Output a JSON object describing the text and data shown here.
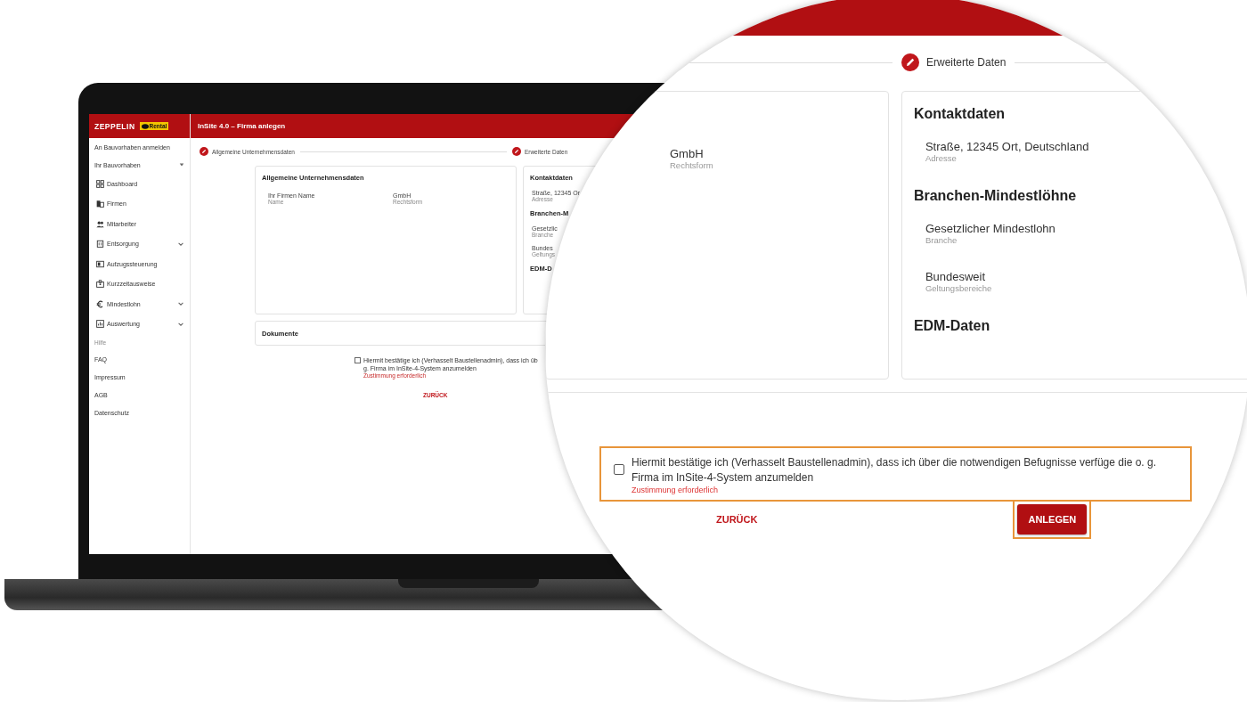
{
  "app": {
    "brand": {
      "name": "ZEPPELIN",
      "badge": "Rental"
    },
    "header_title": "InSite 4.0 – Firma anlegen",
    "sidebar": [
      {
        "kind": "link",
        "label": "An Bauvorhaben anmelden"
      },
      {
        "kind": "group",
        "label": "Ihr Bauvorhaben"
      },
      {
        "kind": "nav",
        "label": "Dashboard",
        "expandable": false
      },
      {
        "kind": "nav",
        "label": "Firmen",
        "expandable": false
      },
      {
        "kind": "nav",
        "label": "Mitarbeiter",
        "expandable": false
      },
      {
        "kind": "nav",
        "label": "Entsorgung",
        "expandable": true
      },
      {
        "kind": "nav",
        "label": "Aufzugssteuerung",
        "expandable": false
      },
      {
        "kind": "nav",
        "label": "Kurzzeitausweise",
        "expandable": false
      },
      {
        "kind": "nav",
        "label": "Mindestlohn",
        "expandable": true
      },
      {
        "kind": "nav",
        "label": "Auswertung",
        "expandable": true
      },
      {
        "kind": "section",
        "label": "Hilfe"
      },
      {
        "kind": "link",
        "label": "FAQ"
      },
      {
        "kind": "link",
        "label": "Impressum"
      },
      {
        "kind": "link",
        "label": "AGB"
      },
      {
        "kind": "link",
        "label": "Datenschutz"
      }
    ],
    "steps": [
      {
        "label": "Allgemeine Unternehmensdaten"
      },
      {
        "label": "Erweiterte Daten"
      }
    ],
    "general_card": {
      "title": "Allgemeine Unternehmensdaten",
      "fields": [
        {
          "value": "Ihr Firmen Name",
          "label": "Name"
        },
        {
          "value": "GmbH",
          "label": "Rechtsform"
        }
      ]
    },
    "extended_card": {
      "sections": [
        {
          "title": "Kontaktdaten",
          "fields": [
            {
              "value": "Straße, 12345 Or",
              "label": "Adresse"
            }
          ]
        },
        {
          "title": "Branchen-M",
          "fields": [
            {
              "value": "Gesetzlic",
              "label": "Branche"
            },
            {
              "value": "Bundes",
              "label": "Geltungs"
            }
          ]
        },
        {
          "title": "EDM-D"
        }
      ]
    },
    "documents_title": "Dokumente",
    "consent": {
      "checked": false,
      "lines": [
        "Hiermit bestätige ich (Verhasselt Baustellenadmin), dass ich üb",
        "g. Firma im InSite-4-System anzumelden"
      ],
      "error": "Zustimmung erforderlich"
    },
    "back_button": "ZURÜCK"
  },
  "magnifier": {
    "step_label": "Erweiterte Daten",
    "left_fields": [
      {
        "value": "GmbH",
        "label": "Rechtsform"
      }
    ],
    "sections": [
      {
        "title": "Kontaktdaten",
        "fields": [
          {
            "value": "Straße, 12345 Ort, Deutschland",
            "label": "Adresse"
          }
        ]
      },
      {
        "title": "Branchen-Mindestlöhne",
        "fields": [
          {
            "value": "Gesetzlicher Mindestlohn",
            "label": "Branche"
          },
          {
            "value": "Bundesweit",
            "label": "Geltungsbereiche"
          }
        ]
      },
      {
        "title": "EDM-Daten"
      }
    ],
    "consent": {
      "checked": false,
      "highlighted": true,
      "text": "Hiermit bestätige ich (Verhasselt Baustellenadmin), dass ich über die notwendigen Befugnisse verfüge die o. g. Firma im InSite-4-System anzumelden",
      "error": "Zustimmung erforderlich"
    },
    "back_button": "ZURÜCK",
    "submit_button": {
      "label": "ANLEGEN",
      "highlighted": true
    }
  }
}
